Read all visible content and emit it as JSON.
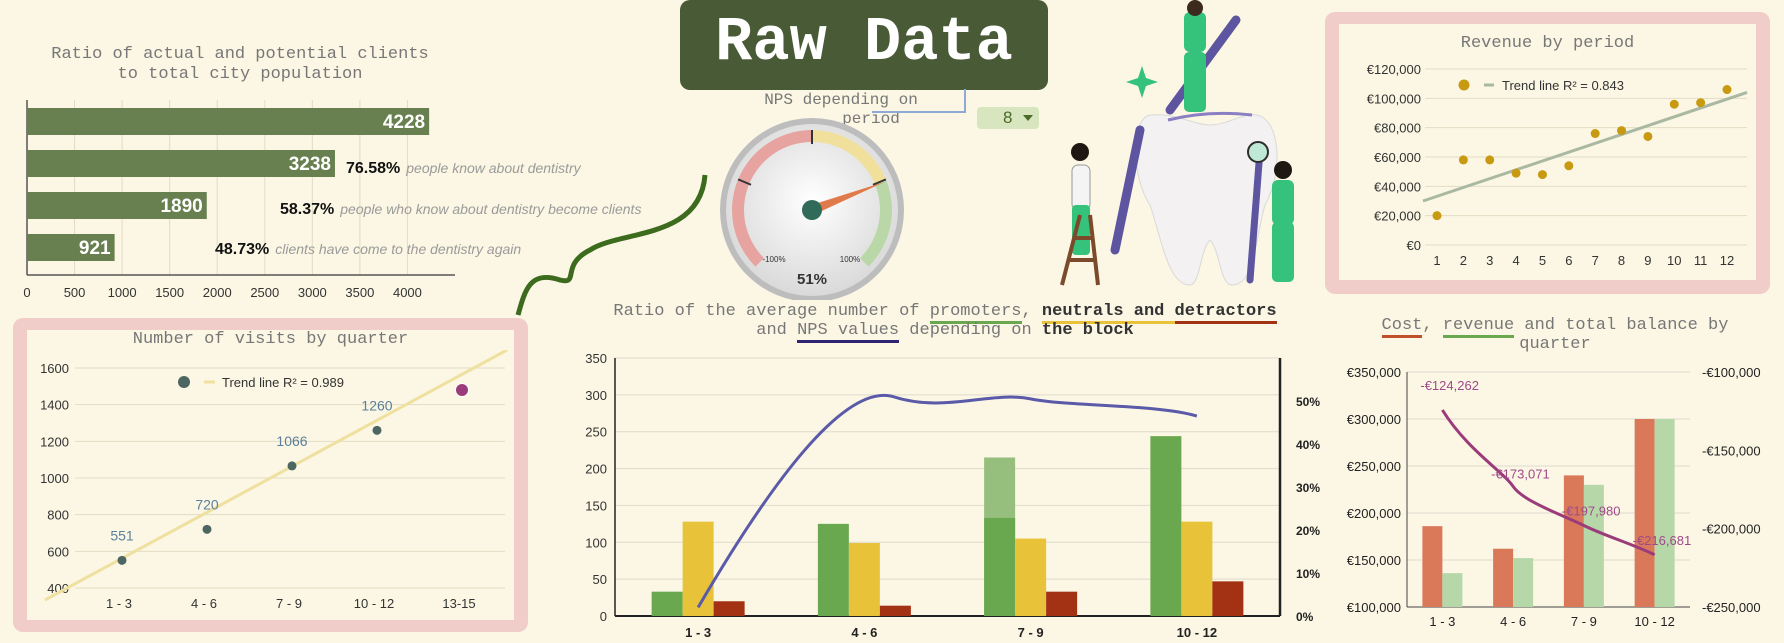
{
  "header": {
    "title": "Raw Data"
  },
  "nps_gauge": {
    "title_line1": "NPS depending on",
    "title_line2": "period",
    "selected_period": "8",
    "value_label": "51%",
    "min_label": "-100%",
    "max_label": "100%",
    "value": 51
  },
  "funnel": {
    "title_line1": "Ratio of actual and potential clients",
    "title_line2": "to total city population",
    "annotations": [
      {
        "pct": "76.58%",
        "text": "people know about dentistry"
      },
      {
        "pct": "58.37%",
        "text": "people who know about dentistry become clients"
      },
      {
        "pct": "48.73%",
        "text": "clients have come to the dentistry again"
      }
    ]
  },
  "visits": {
    "title": "Number of visits by quarter",
    "legend_trend": "Trend line R² = 0.989"
  },
  "revenue_period": {
    "title": "Revenue by period",
    "legend_trend": "Trend line R² = 0.843"
  },
  "promoters": {
    "title_line1_words": [
      "Ratio of the average number of ",
      "promoters",
      ", ",
      "neutrals and ",
      "detractors"
    ],
    "title_line2_words": [
      "and ",
      "NPS values",
      " depending on ",
      "the block"
    ]
  },
  "balance": {
    "title_line1_words": [
      "Cost",
      ", ",
      "revenue",
      " and total balance by"
    ],
    "title_line2": "quarter"
  },
  "colors": {
    "dark_green": "#68804f",
    "green": "#6aa84f",
    "light_green": "#b6d7a8",
    "yellow": "#e8c33a",
    "red": "#a33215",
    "orange": "#d9795a",
    "purple": "#5a5aa8",
    "magenta": "#9b3b7a",
    "pink": "#f0cdc8",
    "background": "#fbf7e4",
    "gold": "#c79a12"
  },
  "chart_data": [
    {
      "id": "funnel",
      "type": "bar",
      "orientation": "horizontal",
      "title": "Ratio of actual and potential clients to total city population",
      "categories": [
        "",
        "",
        "",
        ""
      ],
      "values": [
        4228,
        3238,
        1890,
        921
      ],
      "xlim": [
        0,
        4500
      ],
      "xticks": [
        0,
        500,
        1000,
        1500,
        2000,
        2500,
        3000,
        3500,
        4000
      ],
      "grid": true
    },
    {
      "id": "visits",
      "type": "scatter",
      "title": "Number of visits by quarter",
      "categories": [
        "1 - 3",
        "4 - 6",
        "7 - 9",
        "10 - 12",
        "13-15"
      ],
      "values": [
        551,
        720,
        1066,
        1260,
        1480
      ],
      "labels": [
        "551",
        "720",
        "1066",
        "1260",
        ""
      ],
      "ylim": [
        400,
        1600
      ],
      "yticks": [
        400,
        600,
        800,
        1000,
        1200,
        1400,
        1600
      ],
      "trend": {
        "r2": 0.989
      },
      "legend": "top"
    },
    {
      "id": "revenue_period",
      "type": "scatter",
      "title": "Revenue by period",
      "x": [
        1,
        2,
        3,
        4,
        5,
        6,
        7,
        8,
        9,
        10,
        11,
        12
      ],
      "values": [
        20000,
        58000,
        58000,
        49000,
        48000,
        54000,
        76000,
        78000,
        74000,
        96000,
        97000,
        106000
      ],
      "ylim": [
        0,
        120000
      ],
      "yticks": [
        0,
        20000,
        40000,
        60000,
        80000,
        100000,
        120000
      ],
      "ytick_labels": [
        "€0",
        "€20,000",
        "€40,000",
        "€60,000",
        "€80,000",
        "€100,000",
        "€120,000"
      ],
      "trend": {
        "r2": 0.843
      },
      "legend": "top"
    },
    {
      "id": "promoters",
      "type": "bar",
      "title": "Ratio of the average number of promoters, neutrals and detractors and NPS values depending on the block",
      "categories": [
        "1 - 3",
        "4 - 6",
        "7 - 9",
        "10 - 12"
      ],
      "series": [
        {
          "values": [
            33,
            125,
            133,
            244
          ]
        },
        {
          "values": [
            128,
            99,
            105,
            128
          ]
        },
        {
          "values": [
            20,
            14,
            33,
            47
          ]
        }
      ],
      "extra_bar": {
        "category_index": 2,
        "value": 215
      },
      "line_series": {
        "axis": "right",
        "values": [
          0.02,
          0.5,
          0.505,
          0.465
        ]
      },
      "ylim": [
        0,
        350
      ],
      "yticks": [
        0,
        50,
        100,
        150,
        200,
        250,
        300,
        350
      ],
      "y2lim": [
        0,
        0.6
      ],
      "y2ticks": [
        "0%",
        "10%",
        "20%",
        "30%",
        "40%",
        "50%"
      ]
    },
    {
      "id": "balance",
      "type": "bar",
      "title": "Cost, revenue and total balance by quarter",
      "categories": [
        "1 - 3",
        "4 - 6",
        "7 - 9",
        "10 - 12"
      ],
      "series": [
        {
          "values": [
            186000,
            162000,
            240000,
            300000
          ]
        },
        {
          "values": [
            136000,
            152000,
            230000,
            300000
          ]
        }
      ],
      "line_series": {
        "axis": "right",
        "values": [
          -124262,
          -173071,
          -197980,
          -216681
        ],
        "labels": [
          "-€124,262",
          "-€173,071",
          "-€197,980",
          "-€216,681"
        ]
      },
      "ylim": [
        100000,
        350000
      ],
      "ytick_labels": [
        "€100,000",
        "€150,000",
        "€200,000",
        "€250,000",
        "€300,000",
        "€350,000"
      ],
      "y2lim": [
        -250000,
        -100000
      ],
      "y2tick_labels": [
        "-€250,000",
        "-€200,000",
        "-€150,000",
        "-€100,000"
      ]
    }
  ]
}
